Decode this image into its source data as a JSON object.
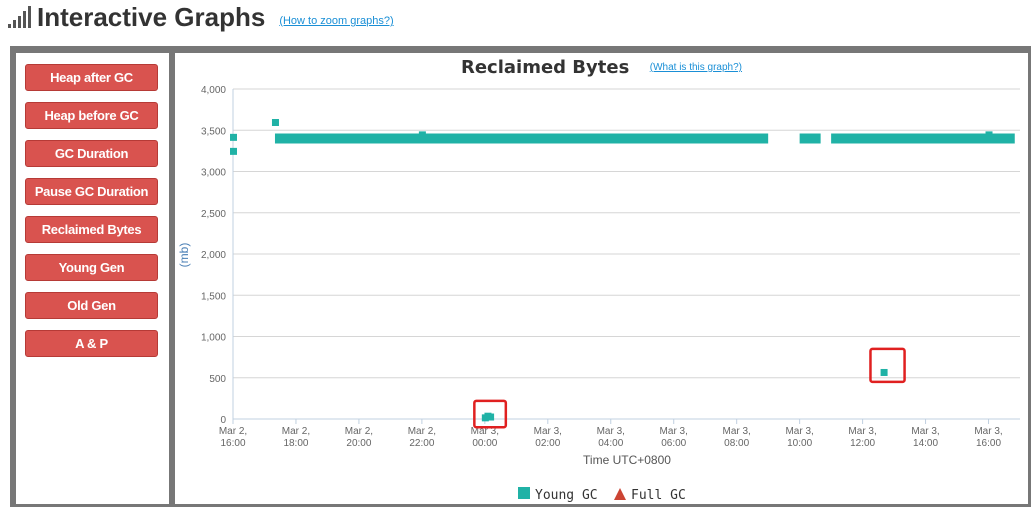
{
  "header": {
    "title": "Interactive Graphs",
    "help_link": "(How to zoom graphs?)"
  },
  "sidebar": {
    "buttons": [
      {
        "label": "Heap after GC"
      },
      {
        "label": "Heap before GC"
      },
      {
        "label": "GC Duration"
      },
      {
        "label": "Pause GC Duration"
      },
      {
        "label": "Reclaimed Bytes"
      },
      {
        "label": "Young Gen"
      },
      {
        "label": "Old Gen"
      },
      {
        "label": "A & P"
      }
    ]
  },
  "chart_header": {
    "title": "Reclaimed Bytes",
    "help_link": "(What is this graph?)"
  },
  "colors": {
    "young_gc": "#20b2a6",
    "full_gc": "#cc4433",
    "button": "#d9534f",
    "highlight_box": "#e02020"
  },
  "chart_data": {
    "type": "scatter",
    "title": "Reclaimed Bytes",
    "xlabel": "Time UTC+0800",
    "ylabel": "(mb)",
    "ylim": [
      0,
      4000
    ],
    "yticks": [
      "0",
      "500",
      "1,000",
      "1,500",
      "2,000",
      "2,500",
      "3,000",
      "3,500",
      "4,000"
    ],
    "xlim": [
      "Mar 2, 16:00",
      "Mar 3, 17:00"
    ],
    "xticks": [
      {
        "line1": "Mar 2,",
        "line2": "16:00"
      },
      {
        "line1": "Mar 2,",
        "line2": "18:00"
      },
      {
        "line1": "Mar 2,",
        "line2": "20:00"
      },
      {
        "line1": "Mar 2,",
        "line2": "22:00"
      },
      {
        "line1": "Mar 3,",
        "line2": "00:00"
      },
      {
        "line1": "Mar 3,",
        "line2": "02:00"
      },
      {
        "line1": "Mar 3,",
        "line2": "04:00"
      },
      {
        "line1": "Mar 3,",
        "line2": "06:00"
      },
      {
        "line1": "Mar 3,",
        "line2": "08:00"
      },
      {
        "line1": "Mar 3,",
        "line2": "10:00"
      },
      {
        "line1": "Mar 3,",
        "line2": "12:00"
      },
      {
        "line1": "Mar 3,",
        "line2": "14:00"
      },
      {
        "line1": "Mar 3,",
        "line2": "16:00"
      }
    ],
    "grid": true,
    "legend_position": "bottom-center",
    "series": [
      {
        "name": "Young GC",
        "marker": "square",
        "bands": [
          {
            "x_start": "Mar 2, 17:20",
            "x_end": "Mar 3, 09:00",
            "y": 3400
          },
          {
            "x_start": "Mar 3, 10:00",
            "x_end": "Mar 3, 10:40",
            "y": 3400
          },
          {
            "x_start": "Mar 3, 11:00",
            "x_end": "Mar 3, 16:50",
            "y": 3400
          }
        ],
        "points": [
          {
            "x": "Mar 2, 16:00",
            "y": 3420
          },
          {
            "x": "Mar 2, 16:00",
            "y": 3250
          },
          {
            "x": "Mar 2, 17:20",
            "y": 3600
          },
          {
            "x": "Mar 2, 22:00",
            "y": 3450
          },
          {
            "x": "Mar 3, 00:00",
            "y": 20
          },
          {
            "x": "Mar 3, 00:05",
            "y": 40
          },
          {
            "x": "Mar 3, 00:10",
            "y": 30
          },
          {
            "x": "Mar 3, 12:40",
            "y": 570
          },
          {
            "x": "Mar 3, 16:00",
            "y": 3450
          }
        ],
        "highlighted": [
          {
            "x_start": "Mar 2, 23:40",
            "x_end": "Mar 3, 00:40",
            "y_min": -100,
            "y_max": 220
          },
          {
            "x_start": "Mar 3, 12:15",
            "x_end": "Mar 3, 13:20",
            "y_min": 450,
            "y_max": 850
          }
        ]
      },
      {
        "name": "Full GC",
        "marker": "triangle",
        "points": []
      }
    ]
  }
}
